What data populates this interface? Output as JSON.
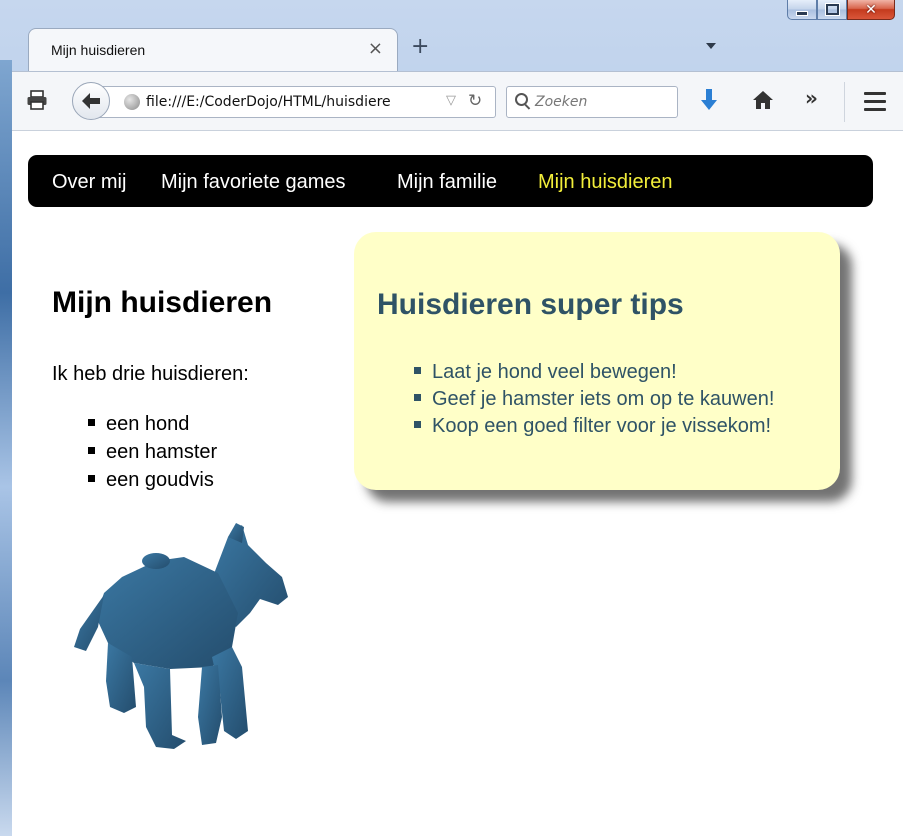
{
  "browser": {
    "tab_title": "Mijn huisdieren",
    "tab_close": "×",
    "new_tab": "+",
    "url": "file:///E:/CoderDojo/HTML/huisdiere",
    "search_placeholder": "Zoeken",
    "more_label": "»"
  },
  "page": {
    "nav": [
      {
        "label": "Over mij",
        "active": false
      },
      {
        "label": "Mijn favoriete games",
        "active": false
      },
      {
        "label": "Mijn familie",
        "active": false
      },
      {
        "label": "Mijn huisdieren",
        "active": true
      }
    ],
    "title": "Mijn huisdieren",
    "intro": "Ik heb drie huisdieren:",
    "pets": [
      "een hond",
      "een hamster",
      "een goudvis"
    ],
    "tips": {
      "title": "Huisdieren super tips",
      "items": [
        "Laat je hond veel bewegen!",
        "Geef je hamster iets om op te kauwen!",
        "Koop een goed filter voor je vissekom!"
      ]
    }
  },
  "colors": {
    "nav_bg": "#000000",
    "nav_text": "#ffffff",
    "nav_active": "#f2ee3a",
    "tips_bg": "#ffffc8",
    "tips_text": "#2f5366",
    "dog": "#2e5f84"
  }
}
